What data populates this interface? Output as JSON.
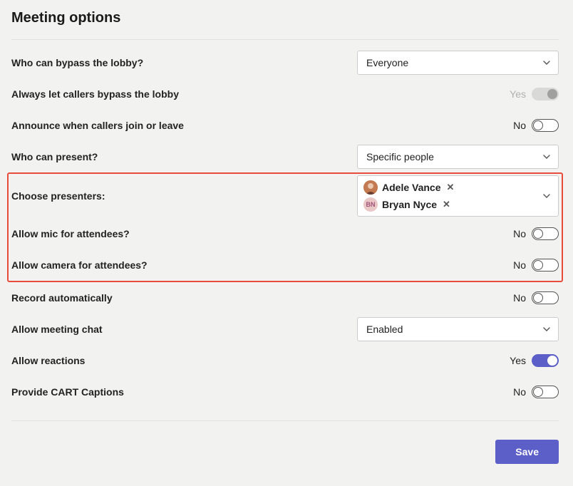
{
  "title": "Meeting options",
  "options": {
    "bypass_lobby": {
      "label": "Who can bypass the lobby?",
      "value": "Everyone"
    },
    "callers_bypass": {
      "label": "Always let callers bypass the lobby",
      "state_text": "Yes"
    },
    "announce": {
      "label": "Announce when callers join or leave",
      "state_text": "No"
    },
    "present": {
      "label": "Who can present?",
      "value": "Specific people"
    },
    "choose_presenters": {
      "label": "Choose presenters:"
    },
    "allow_mic": {
      "label": "Allow mic for attendees?",
      "state_text": "No"
    },
    "allow_camera": {
      "label": "Allow camera for attendees?",
      "state_text": "No"
    },
    "record": {
      "label": "Record automatically",
      "state_text": "No"
    },
    "chat": {
      "label": "Allow meeting chat",
      "value": "Enabled"
    },
    "reactions": {
      "label": "Allow reactions",
      "state_text": "Yes"
    },
    "cart": {
      "label": "Provide CART Captions",
      "state_text": "No"
    }
  },
  "presenters": [
    {
      "name": "Adele Vance",
      "avatar_type": "photo"
    },
    {
      "name": "Bryan Nyce",
      "avatar_type": "initials",
      "initials": "BN"
    }
  ],
  "buttons": {
    "save": "Save"
  }
}
